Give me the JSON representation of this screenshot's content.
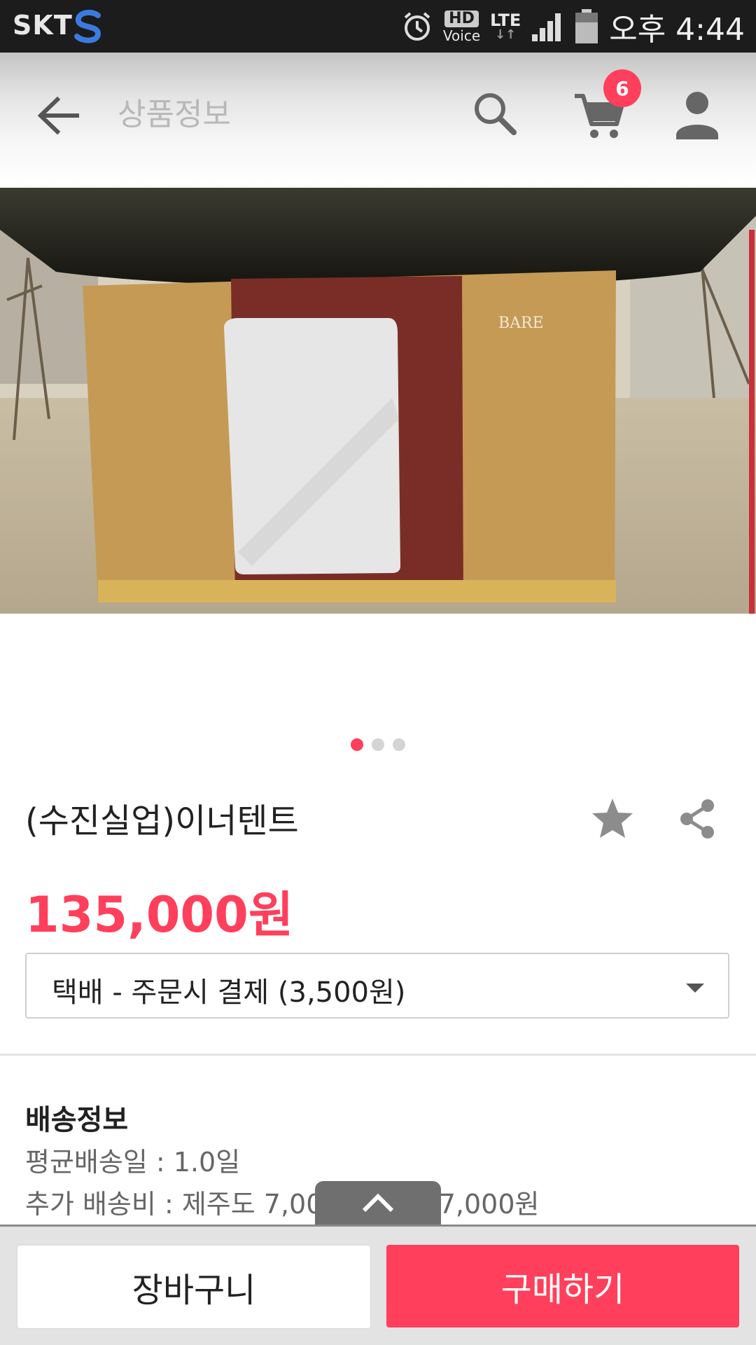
{
  "status_bar": {
    "carrier": "SKT",
    "hd_label": "HD",
    "voice_label": "Voice",
    "network": "LTE",
    "time": "오후 4:44"
  },
  "app_bar": {
    "title": "상품정보",
    "cart_count": "6"
  },
  "gallery": {
    "page_count": 3,
    "current_page": 1,
    "image_brand_text": "BARE"
  },
  "product": {
    "name": "(수진실업)이너텐트",
    "price": "135,000원"
  },
  "shipping_option": {
    "selected": "택배 - 주문시 결제 (3,500원)"
  },
  "delivery": {
    "title": "배송정보",
    "avg_days": "평균배송일 : 1.0일",
    "extra_fee": "추가 배송비 : 제주도 7,000원, 도서 7,000원"
  },
  "actions": {
    "cart_label": "장바구니",
    "buy_label": "구매하기"
  },
  "colors": {
    "accent": "#ff3f5b",
    "status_bar": "#1c1c1c"
  },
  "icons": [
    "back-arrow-icon",
    "search-icon",
    "cart-icon",
    "user-icon",
    "star-icon",
    "share-icon",
    "chevron-up-icon",
    "chevron-down-icon",
    "alarm-icon",
    "signal-icon",
    "battery-icon"
  ]
}
